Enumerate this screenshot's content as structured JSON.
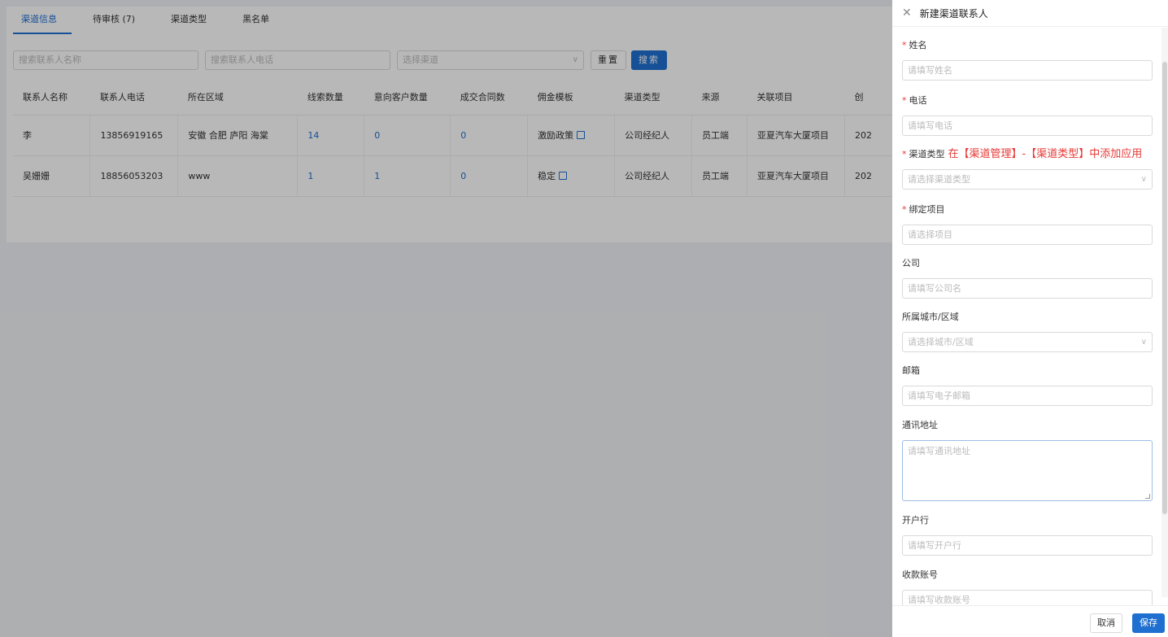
{
  "tabs": [
    {
      "label": "渠道信息"
    },
    {
      "label": "待审核 (7)"
    },
    {
      "label": "渠道类型"
    },
    {
      "label": "黑名单"
    }
  ],
  "filters": {
    "name_placeholder": "搜索联系人名称",
    "phone_placeholder": "搜索联系人电话",
    "channel_placeholder": "选择渠道",
    "reset_label": "重置",
    "search_label": "搜索"
  },
  "table": {
    "headers": [
      "联系人名称",
      "联系人电话",
      "所在区域",
      "线索数量",
      "意向客户数量",
      "成交合同数",
      "佣金模板",
      "渠道类型",
      "来源",
      "关联项目",
      "创"
    ],
    "rows": [
      {
        "name": "李",
        "phone": "13856919165",
        "region": "安徽 合肥 庐阳 海棠",
        "leads": "14",
        "intent": "0",
        "contracts": "0",
        "template": "激励政策",
        "type": "公司经纪人",
        "source": "员工端",
        "project": "亚夏汽车大厦项目",
        "created": "202"
      },
      {
        "name": "吴姗姗",
        "phone": "18856053203",
        "region": "www",
        "leads": "1",
        "intent": "1",
        "contracts": "0",
        "template": "稳定",
        "type": "公司经纪人",
        "source": "员工端",
        "project": "亚夏汽车大厦项目",
        "created": "202"
      }
    ]
  },
  "drawer": {
    "title": "新建渠道联系人",
    "fields": {
      "name": {
        "label": "姓名",
        "placeholder": "请填写姓名"
      },
      "phone": {
        "label": "电话",
        "placeholder": "请填写电话"
      },
      "channel_type": {
        "label": "渠道类型",
        "note": "在【渠道管理】-【渠道类型】中添加应用",
        "placeholder": "请选择渠道类型"
      },
      "project": {
        "label": "绑定项目",
        "placeholder": "请选择项目"
      },
      "company": {
        "label": "公司",
        "placeholder": "请填写公司名"
      },
      "city": {
        "label": "所属城市/区域",
        "placeholder": "请选择城市/区域"
      },
      "email": {
        "label": "邮箱",
        "placeholder": "请填写电子邮箱"
      },
      "address": {
        "label": "通讯地址",
        "placeholder": "请填写通讯地址"
      },
      "bank": {
        "label": "开户行",
        "placeholder": "请填写开户行"
      },
      "account": {
        "label": "收款账号",
        "placeholder": "请填写收款账号"
      }
    },
    "cancel_label": "取消",
    "save_label": "保存"
  },
  "colors": {
    "primary": "#1f6fd0",
    "required": "#e53935"
  }
}
